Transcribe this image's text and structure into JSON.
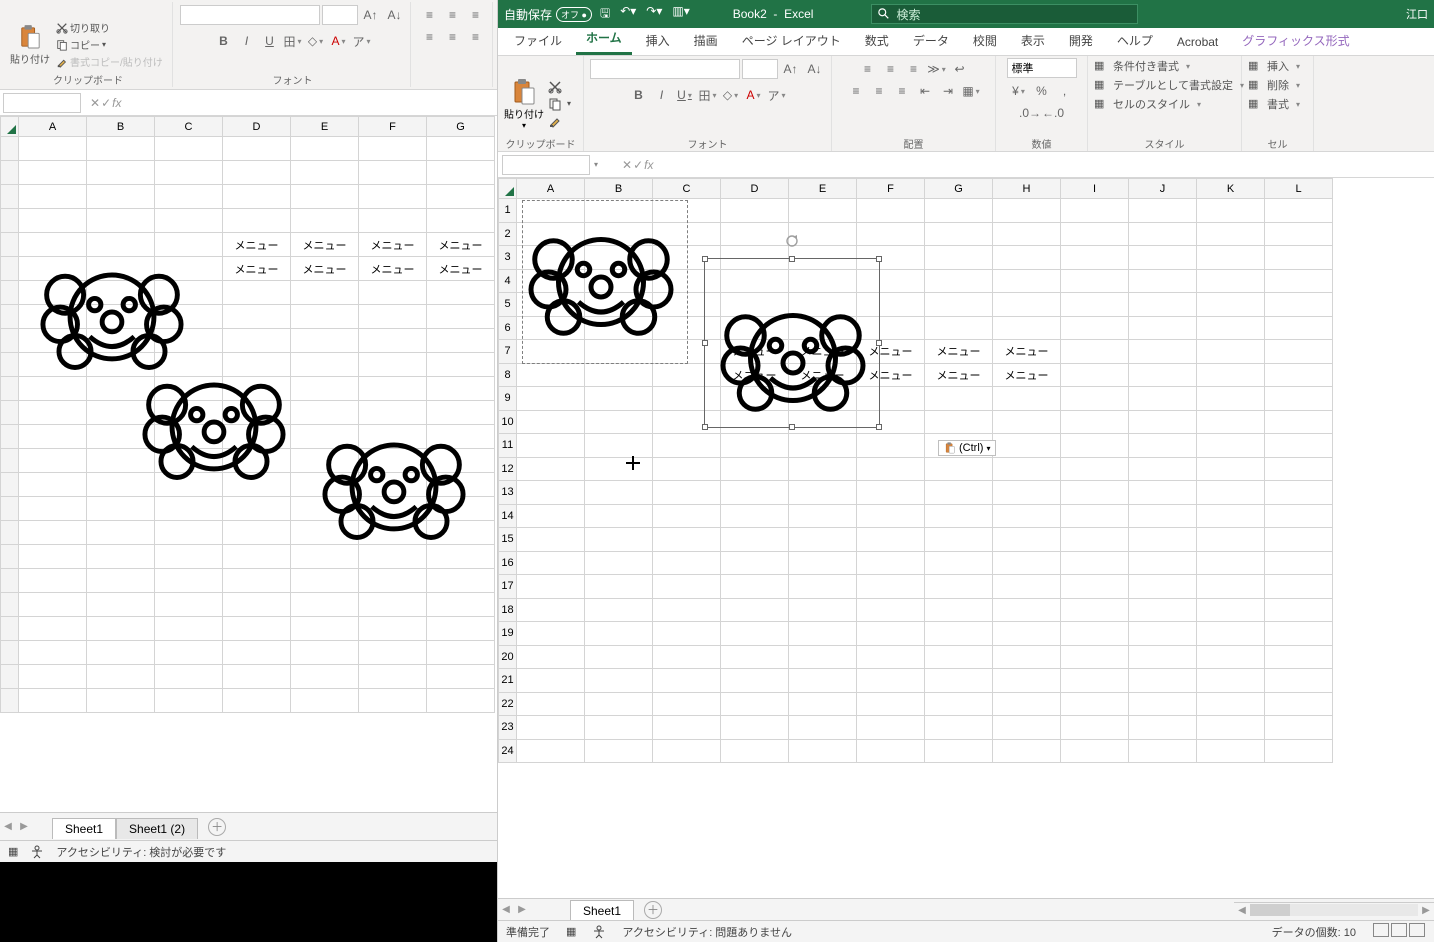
{
  "left": {
    "clipboard": {
      "cut": "切り取り",
      "copy": "コピー",
      "format_painter": "書式コピー/貼り付け",
      "paste": "貼り付け",
      "group_title": "クリップボード"
    },
    "font": {
      "group_title": "フォント"
    },
    "sheet_tabs": {
      "s1": "Sheet1",
      "s2": "Sheet1 (2)"
    },
    "status_acc": "アクセシビリティ: 検討が必要です",
    "cells": {
      "d5": "メニュー",
      "e5": "メニュー",
      "f5": "メニュー",
      "g5": "メニュー",
      "d6": "メニュー",
      "e6": "メニュー",
      "f6": "メニュー",
      "g6": "メニュー"
    },
    "columns": [
      "A",
      "B",
      "C",
      "D",
      "E",
      "F",
      "G"
    ]
  },
  "right": {
    "title": {
      "autosave": "自動保存",
      "autosave_state": "オフ",
      "doc": "Book2",
      "app": "Excel",
      "search_placeholder": "検索",
      "user": "江口"
    },
    "tabs": {
      "file": "ファイル",
      "home": "ホーム",
      "insert": "挿入",
      "draw": "描画",
      "layout": "ページ レイアウト",
      "formulas": "数式",
      "data": "データ",
      "review": "校閲",
      "view": "表示",
      "dev": "開発",
      "help": "ヘルプ",
      "acrobat": "Acrobat",
      "gfx": "グラフィックス形式"
    },
    "ribbon": {
      "clipboard": {
        "paste": "貼り付け",
        "title": "クリップボード"
      },
      "font": {
        "title": "フォント"
      },
      "align": {
        "title": "配置"
      },
      "number": {
        "std": "標準",
        "title": "数値"
      },
      "styles": {
        "cond": "条件付き書式",
        "tbl": "テーブルとして書式設定",
        "cell": "セルのスタイル",
        "title": "スタイル"
      },
      "cells": {
        "ins": "挿入",
        "del": "削除",
        "fmt": "書式",
        "title": "セル"
      }
    },
    "cells": {
      "d7": "メニュー",
      "e7": "メニュー",
      "f7": "メニュー",
      "g7": "メニュー",
      "h7": "メニュー",
      "d8": "メニュー",
      "e8": "メニュー",
      "f8": "メニュー",
      "g8": "メニュー",
      "h8": "メニュー"
    },
    "paste_badge": "(Ctrl)",
    "columns": [
      "A",
      "B",
      "C",
      "D",
      "E",
      "F",
      "G",
      "H",
      "I",
      "J",
      "K",
      "L"
    ],
    "status": {
      "ready": "準備完了",
      "acc": "アクセシビリティ: 問題ありません",
      "count_lbl": "データの個数:",
      "count_val": "10"
    },
    "sheet_tabs": {
      "s1": "Sheet1"
    }
  },
  "icons": {
    "fx": "fx"
  }
}
